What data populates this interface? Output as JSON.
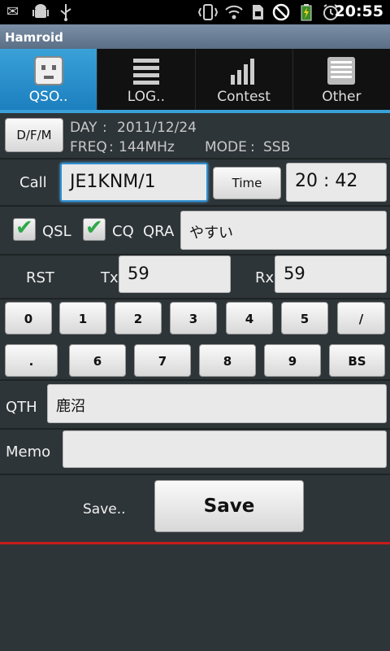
{
  "status": {
    "clock": "20:55"
  },
  "app": {
    "title": "Hamroid"
  },
  "tabs": [
    {
      "label": "QSO..",
      "icon": "robot-icon",
      "active": true
    },
    {
      "label": "LOG..",
      "icon": "list-icon",
      "active": false
    },
    {
      "label": "Contest",
      "icon": "bars-icon",
      "active": false
    },
    {
      "label": "Other",
      "icon": "lines-icon",
      "active": false
    }
  ],
  "info": {
    "dfm_label": "D/F/M",
    "day_label": "DAY",
    "day_value": "2011/12/24",
    "freq_label": "FREQ",
    "freq_value": "144MHz",
    "mode_label": "MODE",
    "mode_value": "SSB"
  },
  "call": {
    "label": "Call",
    "value": "JE1KNM/1",
    "time_label": "Time",
    "time_value": "20 : 42"
  },
  "qra": {
    "qsl_label": "QSL",
    "qsl_checked": true,
    "cq_label": "CQ",
    "cq_checked": true,
    "qra_label": "QRA",
    "qra_value": "やすい"
  },
  "rst": {
    "label": "RST",
    "tx_label": "Tx",
    "tx_value": "59",
    "rx_label": "Rx",
    "rx_value": "59"
  },
  "keypad": {
    "row1": [
      "0",
      "1",
      "2",
      "3",
      "4",
      "5",
      "/"
    ],
    "row2": [
      ".",
      "6",
      "7",
      "8",
      "9",
      "BS"
    ]
  },
  "qth": {
    "label": "QTH",
    "value": "鹿沼"
  },
  "memo": {
    "label": "Memo",
    "value": ""
  },
  "save": {
    "label": "Save..",
    "button": "Save"
  },
  "colors": {
    "accent": "#3aa1d8",
    "redline": "#c81c1c",
    "background": "#2e3538"
  }
}
